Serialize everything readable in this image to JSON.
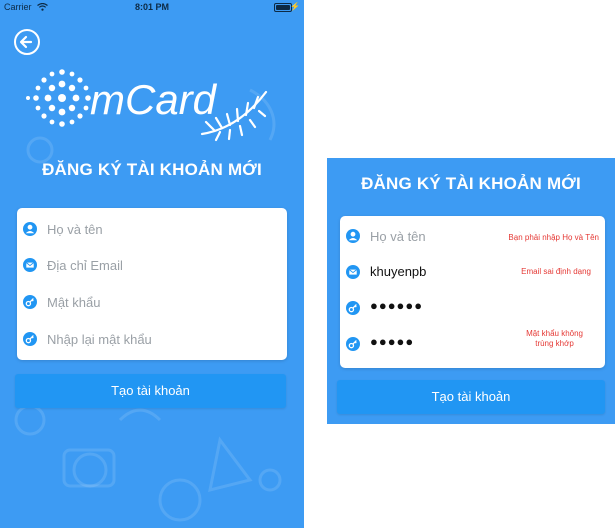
{
  "status_bar": {
    "carrier": "Carrier",
    "time": "8:01 PM"
  },
  "logo": {
    "text": "mCard"
  },
  "left_screen": {
    "title": "ĐĂNG KÝ TÀI KHOẢN MỚI",
    "fields": [
      {
        "icon": "user-icon",
        "placeholder": "Họ và tên"
      },
      {
        "icon": "mail-icon",
        "placeholder": "Địa chỉ Email"
      },
      {
        "icon": "key-icon",
        "placeholder": "Mật khẩu"
      },
      {
        "icon": "key-icon",
        "placeholder": "Nhập lại mật khẩu"
      }
    ],
    "submit_label": "Tạo tài khoản"
  },
  "right_screen": {
    "title": "ĐĂNG KÝ TÀI KHOẢN MỚI",
    "fields": [
      {
        "icon": "user-icon",
        "placeholder": "Họ và tên",
        "value": "",
        "error": "Bạn phải nhập Họ và Tên"
      },
      {
        "icon": "mail-icon",
        "value": "khuyenpb",
        "error": "Email sai định dạng"
      },
      {
        "icon": "key-icon",
        "value": "●●●●●●",
        "error": ""
      },
      {
        "icon": "key-icon",
        "value": "●●●●●",
        "error_line1": "Mật khẩu không",
        "error_line2": "trùng khớp"
      }
    ],
    "submit_label": "Tạo tài khoản"
  },
  "colors": {
    "background": "#3d9bf3",
    "button": "#2196f3",
    "error": "#e53935"
  }
}
